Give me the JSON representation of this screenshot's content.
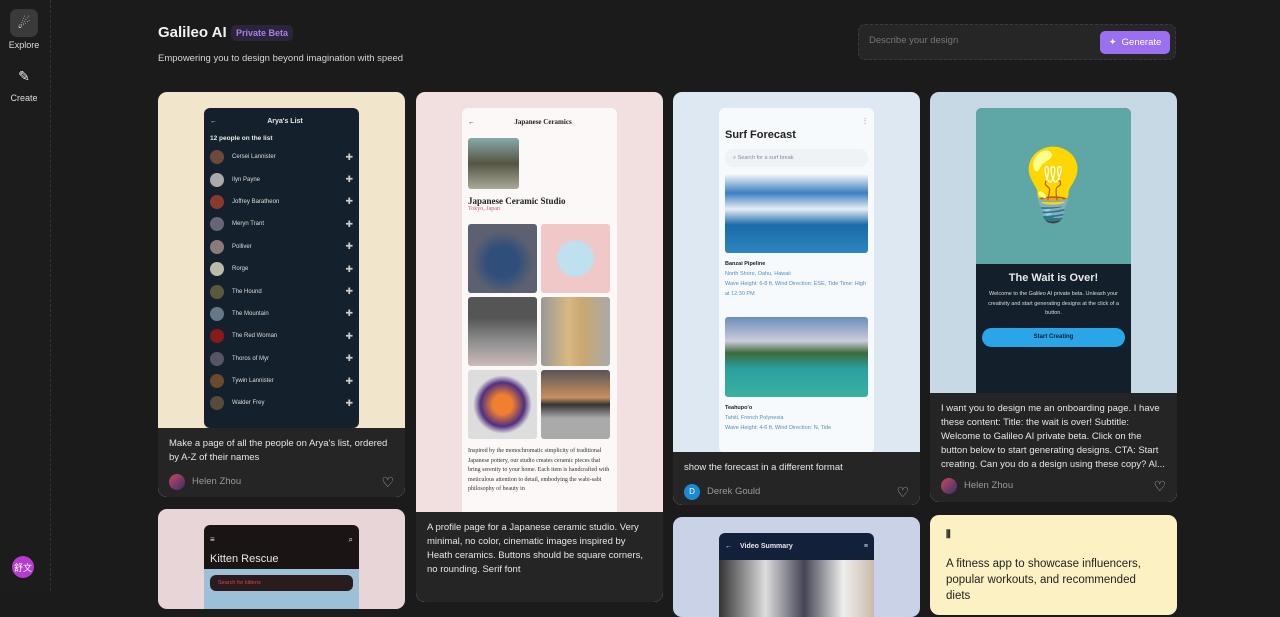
{
  "sidebar": {
    "items": [
      {
        "label": "Explore",
        "icon": "comet-icon"
      },
      {
        "label": "Create",
        "icon": "edit-icon"
      }
    ],
    "user_initials": "舒文",
    "user_color": "#b43ccf"
  },
  "header": {
    "title": "Galileo AI",
    "badge": "Private Beta",
    "subtitle": "Empowering you to design beyond imagination with speed"
  },
  "search": {
    "placeholder": "Describe your design",
    "value": "",
    "generate_label": "Generate",
    "accent": "#9a6ff0"
  },
  "cards": [
    {
      "prompt": "Make a page of all the people on Arya's list, ordered by A-Z of their names",
      "author": "Helen Zhou",
      "preview": {
        "title": "Arya's List",
        "count": "12 people on the list",
        "people": [
          "Cersei Lannister",
          "Ilyn Payne",
          "Joffrey Baratheon",
          "Meryn Trant",
          "Polliver",
          "Rorge",
          "The Hound",
          "The Mountain",
          "The Red Woman",
          "Thoros of Myr",
          "Tywin Lannister",
          "Walder Frey"
        ]
      }
    },
    {
      "prompt": "A profile page for a Japanese ceramic studio. Very minimal, no color, cinematic images inspired by Heath ceramics. Buttons should be square corners, no rounding. Serif font",
      "author": "",
      "preview": {
        "title": "Japanese Ceramics",
        "name": "Japanese Ceramic Studio",
        "location": "Tokyo, Japan",
        "body": "Inspired by the monochromatic simplicity of traditional Japanese pottery, our studio creates ceramic pieces that bring serenity to your home. Each item is handcrafted with meticulous attention to detail, embodying the wabi-sabi philosophy of beauty in"
      }
    },
    {
      "prompt": "show the forecast in a different format",
      "author": "Derek Gould",
      "author_initial": "D",
      "preview": {
        "title": "Surf Forecast",
        "search_placeholder": "Search for a surf break",
        "spots": [
          {
            "name": "Banzai Pipeline",
            "location": "North Shore, Oahu, Hawaii",
            "details": "Wave Height: 6-8 ft, Wind Direction: ESE, Tide Time: High at 12:30 PM"
          },
          {
            "name": "Teahupo'o",
            "location": "Tahiti, French Polynesia",
            "details": "Wave Height: 4-6 ft, Wind Direction: N, Tide"
          }
        ]
      }
    },
    {
      "prompt": "I want you to design me an onboarding page. I have these content: Title: the wait is over! Subtitle: Welcome to Galileo AI private beta. Click on the button below to start generating designs. CTA: Start creating. Can you do a design using these copy? Al...",
      "author": "Helen Zhou",
      "preview": {
        "title": "The Wait is Over!",
        "body": "Welcome to the Galileo AI private beta. Unleash your creativity and start generating designs at the click of a button.",
        "cta": "Start Creating"
      }
    },
    {
      "preview": {
        "title": "Kitten Rescue",
        "search_placeholder": "Search for kittens"
      }
    },
    {
      "preview": {
        "title": "Video Summary"
      }
    },
    {
      "prompt": "A fitness app to showcase influencers, popular workouts, and recommended diets",
      "icon": "dumbbell-icon"
    }
  ]
}
